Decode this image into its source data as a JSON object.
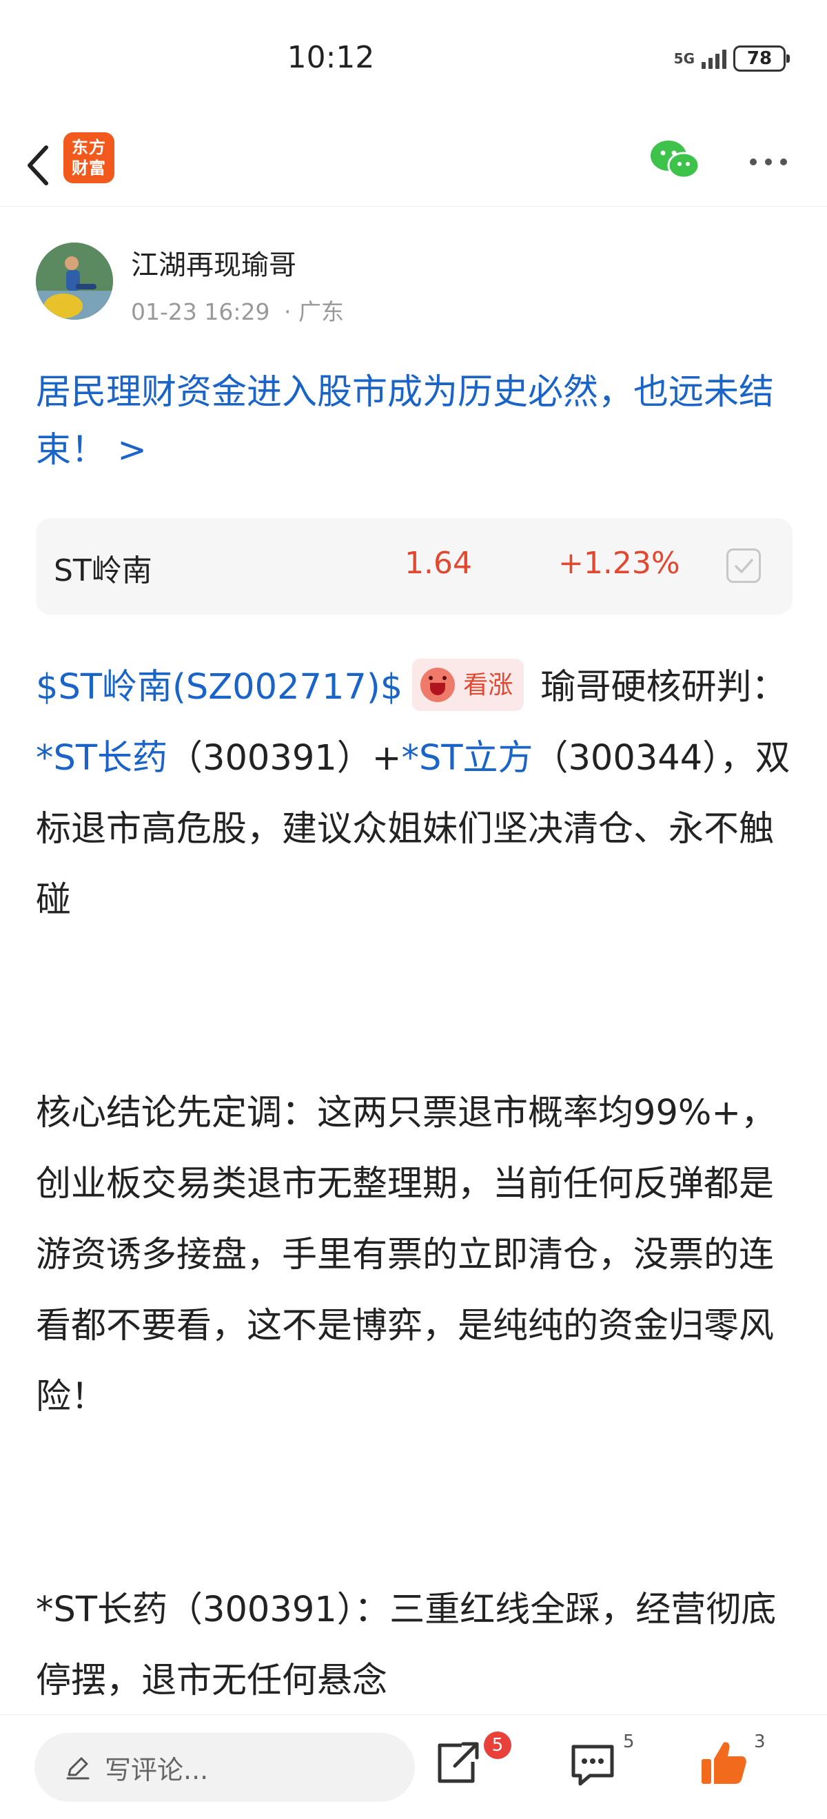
{
  "status": {
    "time": "10:12",
    "network": "5G",
    "battery": "78"
  },
  "nav": {
    "logo_line1": "东方",
    "logo_line2": "财富"
  },
  "author": {
    "name": "江湖再现瑜哥",
    "time": "01-23 16:29",
    "location": "· 广东"
  },
  "post": {
    "title": "居民理财资金进入股市成为历史必然，也远未结束！ >",
    "stock": {
      "name": "ST岭南",
      "price": "1.64",
      "change": "+1.23%"
    },
    "tag": "$ST岭南(SZ002717)$",
    "sentiment": "看涨",
    "intro_a": " 瑜哥硬核研判：",
    "link1": "*ST长药",
    "intro_b": "（300391）+",
    "link2": "*ST立方",
    "intro_c": "（300344），双标退市高危股，建议众姐妹们坚决清仓、永不触碰",
    "para2": "核心结论先定调：这两只票退市概率均99%+，创业板交易类退市无整理期，当前任何反弹都是游资诱多接盘，手里有票的立即清仓，没票的连看都不要看，这不是博弈，是纯纯的资金归零风险！",
    "para3": "*ST长药（300391）：三重红线全踩，经营彻底停摆，退市无任何悬念"
  },
  "bottom": {
    "comment_placeholder": "写评论...",
    "share_badge": "5",
    "comment_count": "5",
    "like_count": "3"
  },
  "colors": {
    "link": "#1a64c8",
    "up": "#e0492f",
    "brand": "#f2591c"
  }
}
